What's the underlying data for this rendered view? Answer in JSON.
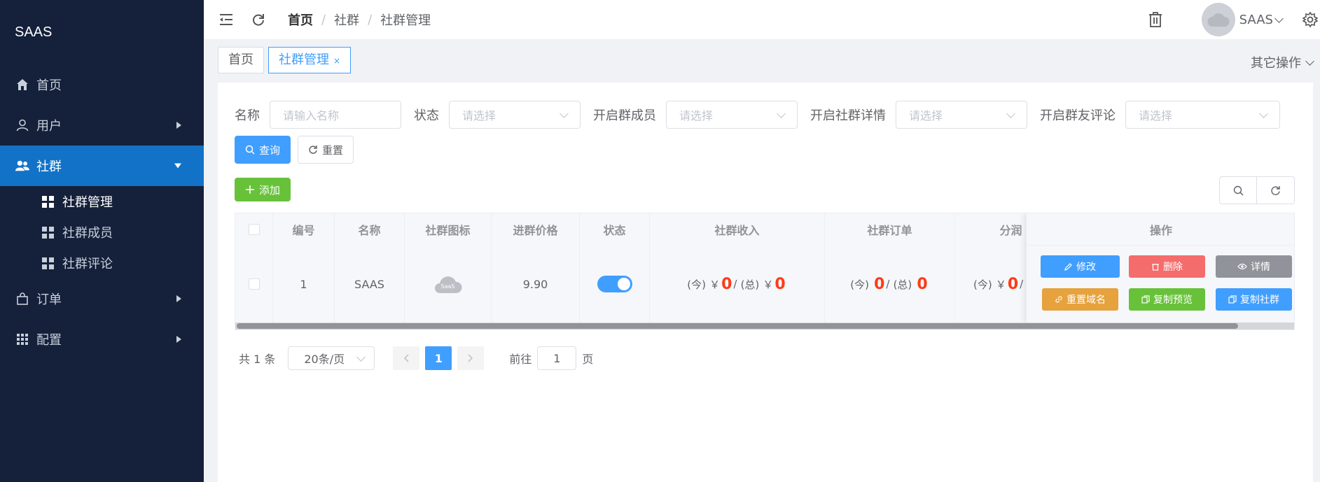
{
  "app": {
    "logo": "SAAS"
  },
  "sidebar": {
    "items": [
      {
        "label": "首页",
        "icon": "home-icon"
      },
      {
        "label": "用户",
        "icon": "user-icon"
      },
      {
        "label": "社群",
        "icon": "group-icon",
        "active": true,
        "children": [
          {
            "label": "社群管理",
            "current": true
          },
          {
            "label": "社群成员"
          },
          {
            "label": "社群评论"
          }
        ]
      },
      {
        "label": "订单",
        "icon": "bag-icon"
      },
      {
        "label": "配置",
        "icon": "grid-icon"
      }
    ]
  },
  "header": {
    "breadcrumb": [
      "首页",
      "社群",
      "社群管理"
    ],
    "user_name": "SAAS"
  },
  "tags": {
    "items": [
      "首页",
      "社群管理"
    ],
    "close": "×",
    "more": "其它操作"
  },
  "filters": {
    "name_label": "名称",
    "name_placeholder": "请输入名称",
    "status_label": "状态",
    "member_label": "开启群成员",
    "detail_label": "开启社群详情",
    "comment_label": "开启群友评论",
    "select_placeholder": "请选择",
    "query": "查询",
    "reset": "重置",
    "add": "添加"
  },
  "table": {
    "columns": [
      "编号",
      "名称",
      "社群图标",
      "进群价格",
      "状态",
      "社群收入",
      "社群订单",
      "分润",
      "操作"
    ],
    "rows": [
      {
        "id": "1",
        "name": "SAAS",
        "icon_text": "SaaS",
        "price": "9.90",
        "status_on": true,
        "income": {
          "today_label": "(今)",
          "today_prefix": "￥",
          "today": "0",
          "slash": "/",
          "total_label": "(总)",
          "total_prefix": "￥",
          "total": "0"
        },
        "orders": {
          "today_label": "(今)",
          "today": "0",
          "slash": "/",
          "total_label": "(总)",
          "total": "0"
        },
        "profit": {
          "today_label": "(今)",
          "today_prefix": "￥",
          "today": "0",
          "slash": "/"
        }
      }
    ],
    "actions": {
      "edit": "修改",
      "delete": "删除",
      "detail": "详情",
      "reset_domain": "重置域名",
      "copy_preview": "复制预览",
      "copy_group": "复制社群"
    }
  },
  "pagination": {
    "total_text": "共 1 条",
    "page_size": "20条/页",
    "current_page": "1",
    "goto_label": "前往",
    "goto_value": "1",
    "page_suffix": "页"
  },
  "colors": {
    "sidebar_bg": "#15203a",
    "sidebar_active": "#1272c7",
    "primary": "#409eff",
    "success": "#67c23a",
    "danger": "#f56c6c",
    "warning": "#e6a23c",
    "info": "#909399",
    "highlight_number": "#ff3a17"
  }
}
